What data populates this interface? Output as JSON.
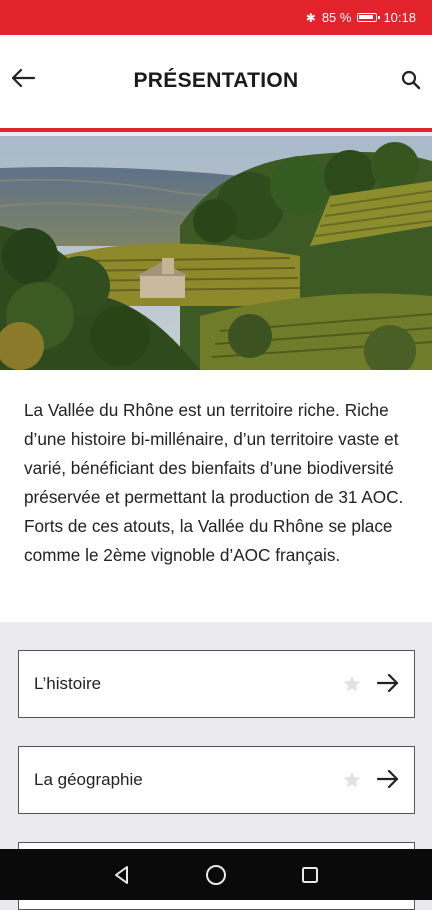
{
  "status_bar": {
    "bluetooth_icon": "bluetooth-icon",
    "battery_percent": "85 %",
    "battery_icon": "battery-icon",
    "time": "10:18"
  },
  "header": {
    "title": "PRÉSENTATION",
    "back_icon": "arrow-left-icon",
    "search_icon": "search-icon",
    "accent_color": "#e2232b"
  },
  "intro": {
    "text": "La Vallée du Rhône est un territoire riche. Riche d’une histoire bi-millénaire, d’un territoire vaste et varié, bénéficiant des bienfaits d’une biodiversité préservée et permettant la production de 31 AOC. Forts de ces atouts, la Vallée du Rhône se place comme le 2ème vignoble d’AOC français."
  },
  "menu": {
    "items": [
      {
        "label": "L’histoire",
        "star_icon": "star-icon",
        "arrow_icon": "arrow-right-icon"
      },
      {
        "label": "La géographie",
        "star_icon": "star-icon",
        "arrow_icon": "arrow-right-icon"
      },
      {
        "label": ""
      }
    ]
  },
  "nav_bar": {
    "back_icon": "triangle-back-icon",
    "home_icon": "circle-home-icon",
    "recents_icon": "square-recents-icon"
  }
}
